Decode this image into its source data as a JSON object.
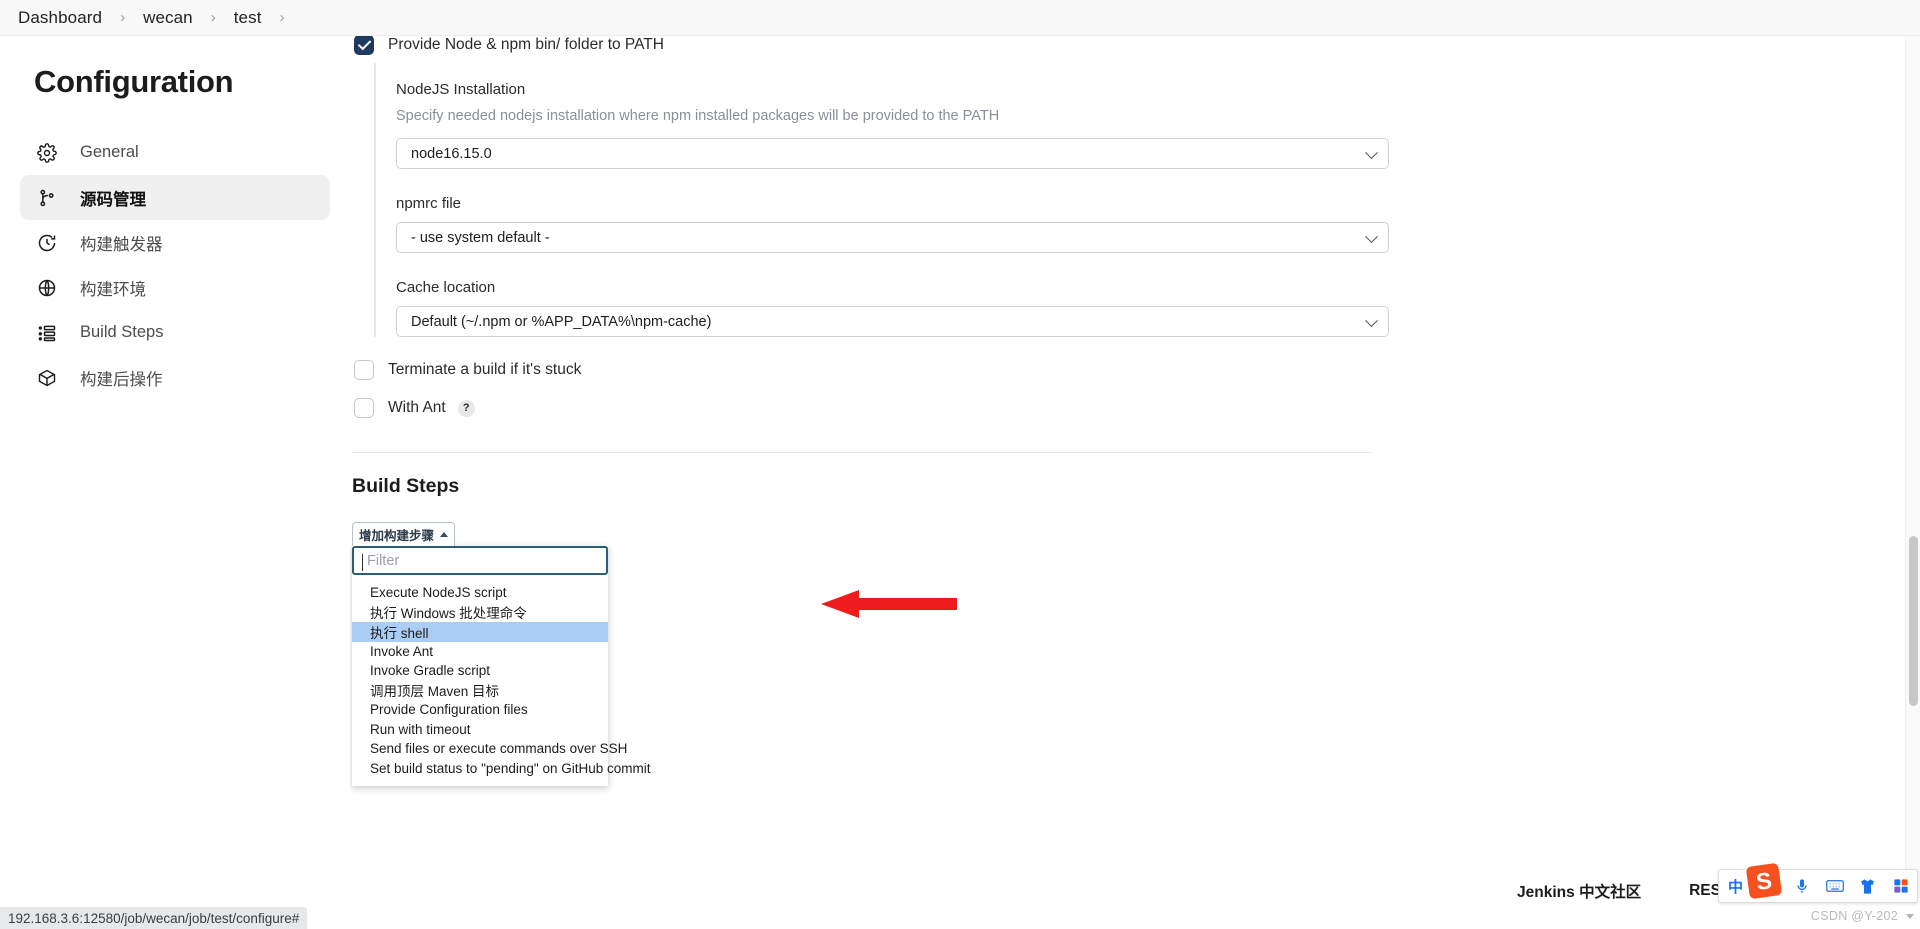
{
  "breadcrumb": {
    "items": [
      "Dashboard",
      "wecan",
      "test"
    ],
    "separator": "›"
  },
  "sidebar": {
    "title": "Configuration",
    "items": [
      {
        "label": "General",
        "icon": "gear-icon",
        "active": false
      },
      {
        "label": "源码管理",
        "icon": "branch-icon",
        "active": true
      },
      {
        "label": "构建触发器",
        "icon": "clock-icon",
        "active": false
      },
      {
        "label": "构建环境",
        "icon": "globe-icon",
        "active": false
      },
      {
        "label": "Build Steps",
        "icon": "list-icon",
        "active": false
      },
      {
        "label": "构建后操作",
        "icon": "package-icon",
        "active": false
      }
    ]
  },
  "main": {
    "provide_node_checkbox": {
      "label": "Provide Node & npm bin/ folder to PATH",
      "checked": true
    },
    "nodejs_installation": {
      "label": "NodeJS Installation",
      "description": "Specify needed nodejs installation where npm installed packages will be provided to the PATH",
      "value": "node16.15.0"
    },
    "npmrc_file": {
      "label": "npmrc file",
      "value": "- use system default -"
    },
    "cache_location": {
      "label": "Cache location",
      "value": "Default (~/.npm or %APP_DATA%\\npm-cache)"
    },
    "terminate_checkbox": {
      "label": "Terminate a build if it's stuck",
      "checked": false
    },
    "with_ant_checkbox": {
      "label": "With Ant",
      "checked": false,
      "help": "?"
    },
    "build_steps": {
      "title": "Build Steps",
      "add_button_label": "增加构建步骤",
      "filter_placeholder": "Filter",
      "filter_value": "",
      "options": [
        {
          "label": "Execute NodeJS script",
          "selected": false
        },
        {
          "label": "执行 Windows 批处理命令",
          "selected": false
        },
        {
          "label": "执行 shell",
          "selected": true
        },
        {
          "label": "Invoke Ant",
          "selected": false
        },
        {
          "label": "Invoke Gradle script",
          "selected": false
        },
        {
          "label": "调用顶层 Maven 目标",
          "selected": false
        },
        {
          "label": "Provide Configuration files",
          "selected": false
        },
        {
          "label": "Run with timeout",
          "selected": false
        },
        {
          "label": "Send files or execute commands over SSH",
          "selected": false
        },
        {
          "label": "Set build status to \"pending\" on GitHub commit",
          "selected": false
        }
      ]
    }
  },
  "status_bar": {
    "url": "192.168.3.6:12580/job/wecan/job/test/configure#"
  },
  "footer": {
    "links": [
      "Jenkins 中文社区",
      "REST API"
    ]
  },
  "tray": {
    "items": [
      "中",
      "°，",
      "mic-icon",
      "keyboard-icon",
      "shirt-icon",
      "apps-icon"
    ]
  },
  "watermark": "CSDN @Y-202",
  "colors": {
    "accent": "#1f3a5f",
    "selection": "#aacdf3",
    "arrow": "#ee1c1c",
    "focus_border": "#2b5f78"
  }
}
